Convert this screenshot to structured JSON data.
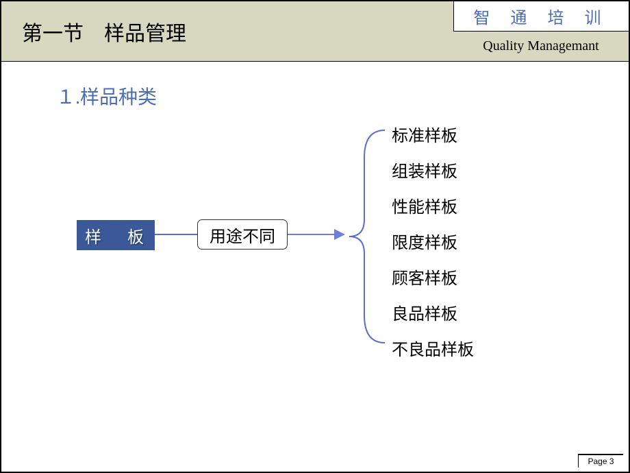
{
  "header": {
    "title": "第一节　样品管理",
    "brand": "智 通 培 训",
    "subbrand": "Quality Managemant"
  },
  "subtitle": "１.样品种类",
  "diagram": {
    "root": "样 板",
    "middle": "用途不同",
    "items": [
      "标准样板",
      "组装样板",
      "性能样板",
      "限度样板",
      "顾客样板",
      "良品样板",
      "不良品样板"
    ]
  },
  "footer": {
    "page": "Page 3"
  }
}
